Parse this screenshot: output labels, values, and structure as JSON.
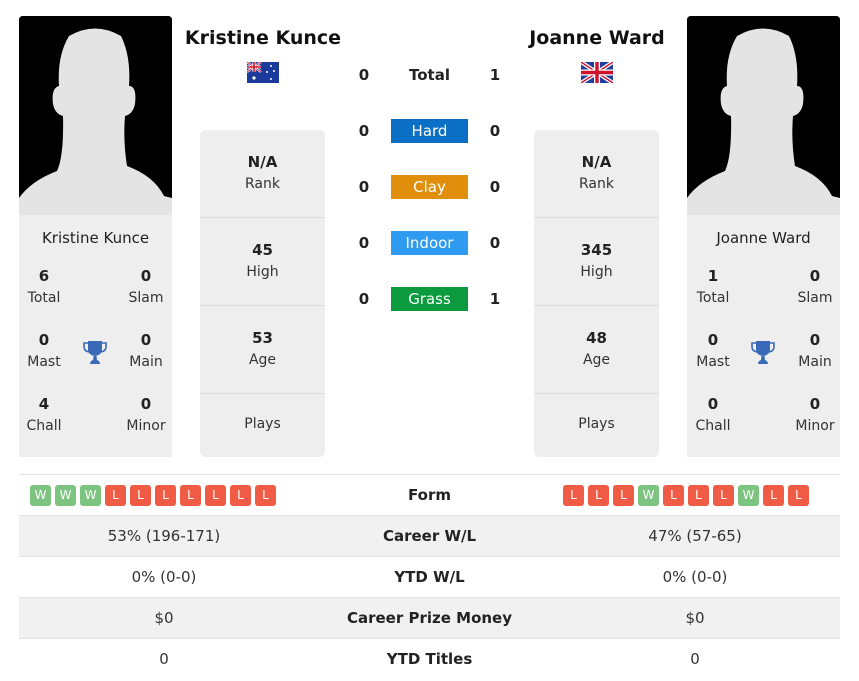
{
  "colors": {
    "hard": "#0b6fc6",
    "clay": "#e08e0b",
    "indoor": "#2e9bf0",
    "grass": "#0b9a3e",
    "win": "#7cc47f",
    "loss": "#ef5b45",
    "trophy": "#3a6ab7"
  },
  "player1": {
    "name": "Kristine Kunce",
    "flag_icon": "australia-flag-icon",
    "titles": {
      "total": {
        "value": "6",
        "label": "Total"
      },
      "slam": {
        "value": "0",
        "label": "Slam"
      },
      "mast": {
        "value": "0",
        "label": "Mast"
      },
      "main": {
        "value": "0",
        "label": "Main"
      },
      "chall": {
        "value": "4",
        "label": "Chall"
      },
      "minor": {
        "value": "0",
        "label": "Minor"
      }
    },
    "info": {
      "rank": {
        "value": "N/A",
        "label": "Rank"
      },
      "high": {
        "value": "45",
        "label": "High"
      },
      "age": {
        "value": "53",
        "label": "Age"
      },
      "plays": {
        "value": "",
        "label": "Plays"
      }
    },
    "form": [
      "W",
      "W",
      "W",
      "L",
      "L",
      "L",
      "L",
      "L",
      "L",
      "L"
    ],
    "career_wl": "53% (196-171)",
    "ytd_wl": "0% (0-0)",
    "career_prize": "$0",
    "ytd_titles": "0"
  },
  "player2": {
    "name": "Joanne Ward",
    "flag_icon": "united-kingdom-flag-icon",
    "titles": {
      "total": {
        "value": "1",
        "label": "Total"
      },
      "slam": {
        "value": "0",
        "label": "Slam"
      },
      "mast": {
        "value": "0",
        "label": "Mast"
      },
      "main": {
        "value": "0",
        "label": "Main"
      },
      "chall": {
        "value": "0",
        "label": "Chall"
      },
      "minor": {
        "value": "0",
        "label": "Minor"
      }
    },
    "info": {
      "rank": {
        "value": "N/A",
        "label": "Rank"
      },
      "high": {
        "value": "345",
        "label": "High"
      },
      "age": {
        "value": "48",
        "label": "Age"
      },
      "plays": {
        "value": "",
        "label": "Plays"
      }
    },
    "form": [
      "L",
      "L",
      "L",
      "W",
      "L",
      "L",
      "L",
      "W",
      "L",
      "L"
    ],
    "career_wl": "47% (57-65)",
    "ytd_wl": "0% (0-0)",
    "career_prize": "$0",
    "ytd_titles": "0"
  },
  "h2h": {
    "total": {
      "label": "Total",
      "p1": "0",
      "p2": "1"
    },
    "hard": {
      "label": "Hard",
      "p1": "0",
      "p2": "0"
    },
    "clay": {
      "label": "Clay",
      "p1": "0",
      "p2": "0"
    },
    "indoor": {
      "label": "Indoor",
      "p1": "0",
      "p2": "0"
    },
    "grass": {
      "label": "Grass",
      "p1": "0",
      "p2": "1"
    }
  },
  "comparison": {
    "form_label": "Form",
    "career_wl_label": "Career W/L",
    "ytd_wl_label": "YTD W/L",
    "career_prize_label": "Career Prize Money",
    "ytd_titles_label": "YTD Titles"
  }
}
